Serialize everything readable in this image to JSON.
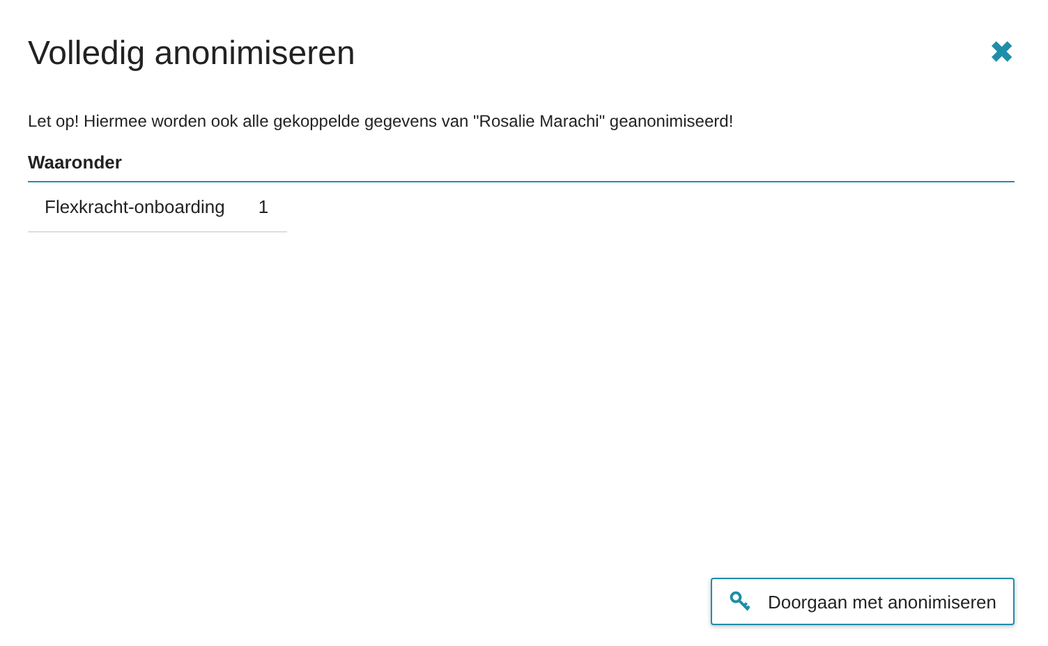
{
  "dialog": {
    "title": "Volledig anonimiseren",
    "close": "✖"
  },
  "warning": "Let op! Hiermee worden ook alle gekoppelde gegevens van \"Rosalie Marachi\" geanonimiseerd!",
  "section": {
    "heading": "Waaronder"
  },
  "rows": [
    {
      "label": "Flexkracht-onboarding",
      "count": "1"
    }
  ],
  "button": {
    "label": "Doorgaan met anonimiseren"
  }
}
